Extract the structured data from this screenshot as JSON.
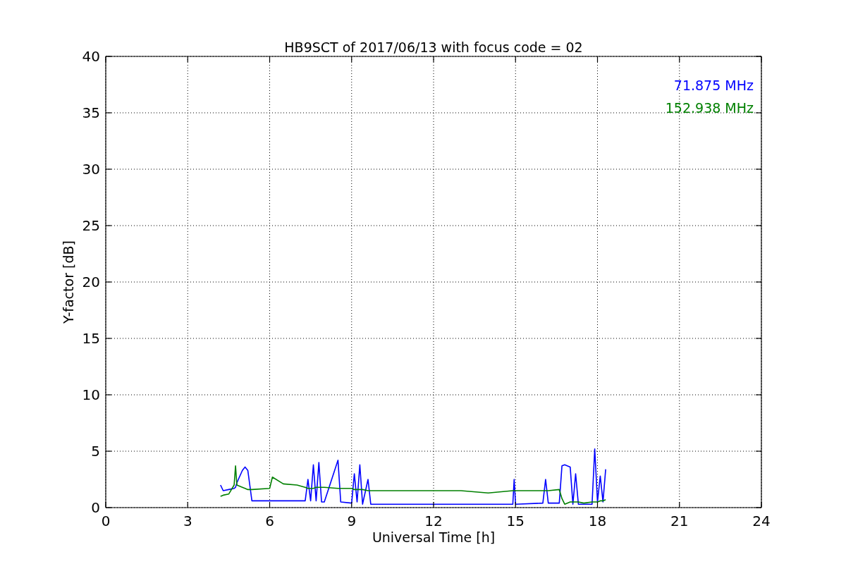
{
  "chart_data": {
    "type": "line",
    "grid": true,
    "title": "HB9SCT of 2017/06/13 with focus code = 02",
    "xlabel": "Universal Time [h]",
    "ylabel": "Y-factor [dB]",
    "xlim": [
      0,
      24
    ],
    "ylim": [
      0,
      40
    ],
    "xticks": [
      0,
      3,
      6,
      9,
      12,
      15,
      18,
      21,
      24
    ],
    "yticks": [
      0,
      5,
      10,
      15,
      20,
      25,
      30,
      35,
      40
    ],
    "x": [
      4.2,
      4.3,
      4.5,
      4.7,
      4.75,
      4.8,
      5.0,
      5.1,
      5.2,
      5.3,
      5.35,
      6.0,
      6.1,
      6.5,
      7.0,
      7.3,
      7.4,
      7.5,
      7.6,
      7.7,
      7.8,
      7.9,
      8.0,
      8.5,
      8.6,
      9.0,
      9.1,
      9.2,
      9.3,
      9.4,
      9.6,
      9.7,
      10.0,
      11.0,
      12.0,
      13.0,
      14.0,
      14.9,
      14.95,
      15.0,
      16.0,
      16.1,
      16.2,
      16.6,
      16.7,
      16.8,
      17.0,
      17.1,
      17.2,
      17.3,
      17.5,
      17.8,
      17.9,
      18.0,
      18.1,
      18.2,
      18.3
    ],
    "series": [
      {
        "name": "71.875 MHz",
        "color": "#0000ff",
        "values": [
          2.0,
          1.5,
          1.6,
          1.7,
          1.8,
          2.2,
          3.3,
          3.6,
          3.3,
          1.5,
          0.6,
          0.6,
          0.6,
          0.6,
          0.6,
          0.6,
          2.5,
          0.6,
          3.8,
          0.6,
          4.0,
          0.5,
          0.5,
          4.2,
          0.5,
          0.4,
          3.0,
          0.5,
          3.8,
          0.3,
          2.5,
          0.3,
          0.3,
          0.3,
          0.3,
          0.3,
          0.3,
          0.3,
          2.5,
          0.3,
          0.4,
          2.5,
          0.4,
          0.4,
          3.7,
          3.8,
          3.6,
          0.3,
          3.0,
          0.3,
          0.3,
          0.3,
          5.2,
          0.5,
          2.8,
          0.5,
          3.4
        ]
      },
      {
        "name": "152.938 MHz",
        "color": "#008000",
        "values": [
          1.0,
          1.1,
          1.2,
          2.0,
          3.7,
          2.0,
          1.8,
          1.7,
          1.6,
          1.6,
          1.6,
          1.7,
          2.7,
          2.1,
          2.0,
          1.8,
          1.7,
          1.7,
          1.7,
          1.8,
          1.8,
          1.8,
          1.8,
          1.7,
          1.7,
          1.7,
          1.6,
          1.6,
          1.6,
          1.6,
          1.5,
          1.5,
          1.5,
          1.5,
          1.5,
          1.5,
          1.3,
          1.5,
          1.5,
          1.5,
          1.5,
          1.5,
          1.5,
          1.6,
          0.8,
          0.3,
          0.5,
          0.5,
          0.5,
          0.5,
          0.4,
          0.5,
          0.5,
          0.5,
          0.6,
          0.6,
          0.7
        ]
      }
    ]
  }
}
